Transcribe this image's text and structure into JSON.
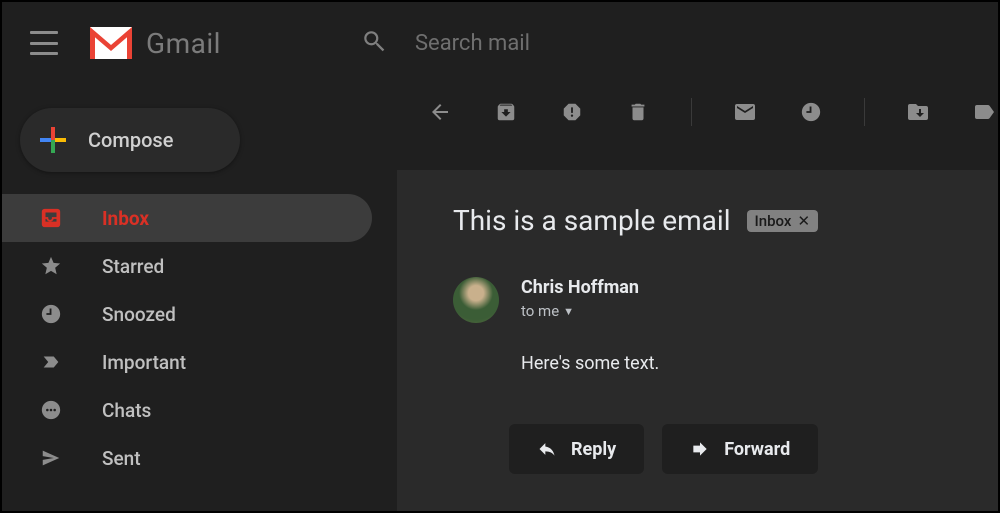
{
  "header": {
    "app_name": "Gmail",
    "search_placeholder": "Search mail"
  },
  "compose_label": "Compose",
  "sidebar": {
    "items": [
      {
        "label": "Inbox",
        "icon": "inbox-icon",
        "active": true
      },
      {
        "label": "Starred",
        "icon": "star-icon"
      },
      {
        "label": "Snoozed",
        "icon": "clock-icon"
      },
      {
        "label": "Important",
        "icon": "important-icon"
      },
      {
        "label": "Chats",
        "icon": "chat-icon"
      },
      {
        "label": "Sent",
        "icon": "sent-icon"
      }
    ]
  },
  "toolbar": {
    "icons": [
      "back-icon",
      "archive-icon",
      "spam-icon",
      "delete-icon",
      "mark-unread-icon",
      "snooze-icon",
      "move-to-icon",
      "labels-icon"
    ]
  },
  "message": {
    "subject": "This is a sample email",
    "label_chip": "Inbox",
    "from": "Chris Hoffman",
    "to_text": "to me",
    "body": "Here's some text.",
    "reply_label": "Reply",
    "forward_label": "Forward"
  }
}
